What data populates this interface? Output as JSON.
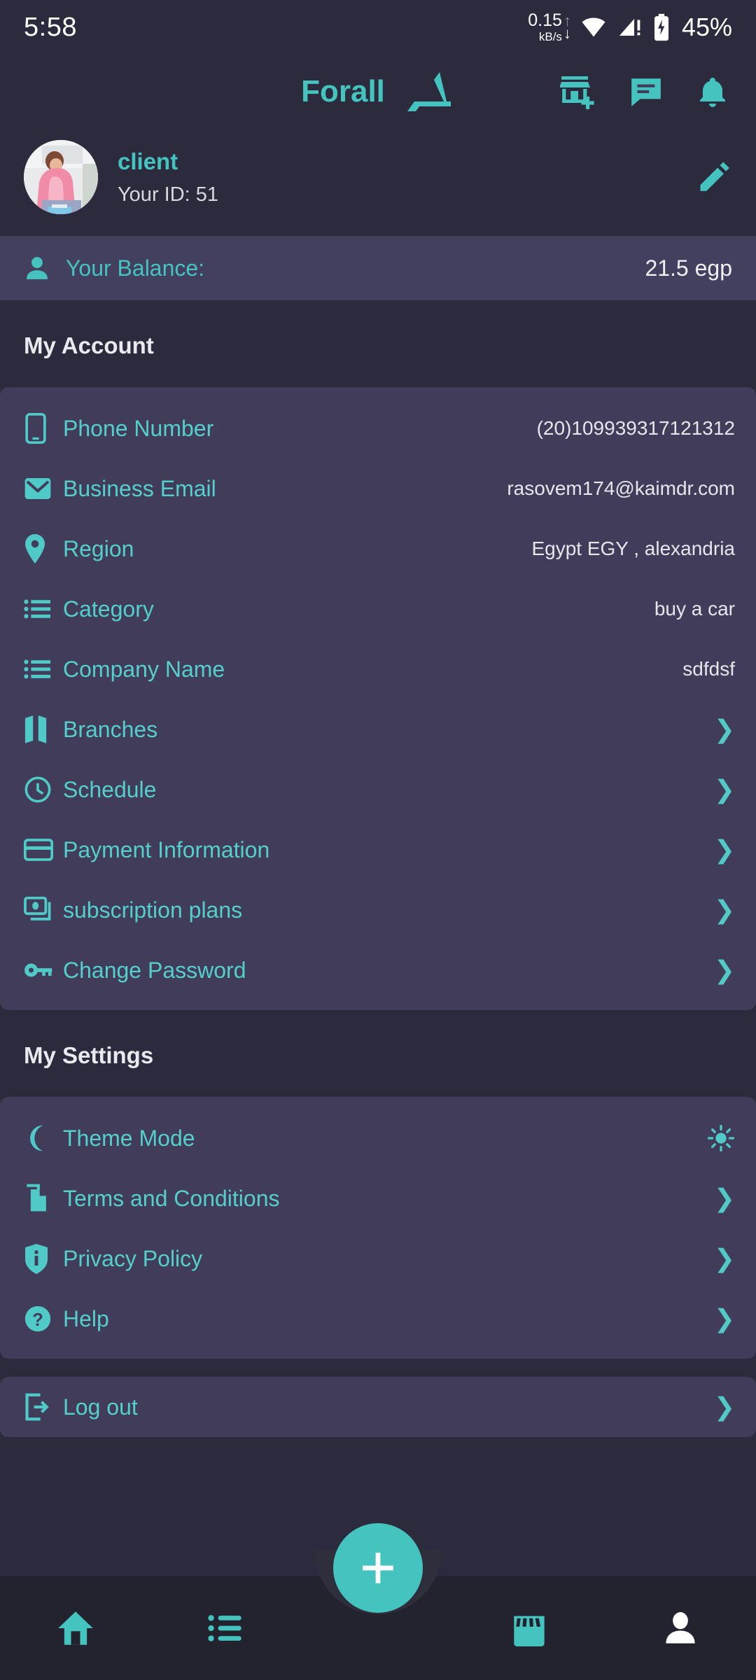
{
  "status_bar": {
    "time": "5:58",
    "net_speed_value": "0.15",
    "net_speed_unit": "kB/s",
    "up_arrow": "↑",
    "down_arrow": "↓",
    "battery_percent": "45%",
    "icons": [
      "upload-arrow-icon",
      "download-arrow-icon",
      "wifi-icon",
      "cellular-signal-warning-icon",
      "battery-icon"
    ]
  },
  "header": {
    "brand_name": "Forall",
    "logo_icon": "forall-arabic-logo-icon",
    "icons": [
      {
        "name": "add-store-icon"
      },
      {
        "name": "chat-message-icon"
      },
      {
        "name": "notification-bell-icon"
      }
    ]
  },
  "profile": {
    "name": "client",
    "id_label": "Your ID: 51",
    "avatar_icon": "user-avatar-photo",
    "edit_icon": "edit-pencil-icon"
  },
  "balance": {
    "icon": "person-icon",
    "label": "Your Balance:",
    "value": "21.5 egp"
  },
  "my_account": {
    "title": "My Account",
    "rows": [
      {
        "icon": "mobile-phone-icon",
        "label": "Phone Number",
        "value": "(20)109939317121312",
        "chevron": false
      },
      {
        "icon": "envelope-icon",
        "label": "Business Email",
        "value": "rasovem174@kaimdr.com",
        "chevron": false
      },
      {
        "icon": "map-pin-icon",
        "label": "Region",
        "value": "Egypt EGY , alexandria",
        "chevron": false
      },
      {
        "icon": "list-icon",
        "label": "Category",
        "value": "buy a car",
        "chevron": false
      },
      {
        "icon": "list-icon",
        "label": "Company Name",
        "value": "sdfdsf",
        "chevron": false
      },
      {
        "icon": "map-folded-icon",
        "label": "Branches",
        "value": "",
        "chevron": true
      },
      {
        "icon": "clock-icon",
        "label": "Schedule",
        "value": "",
        "chevron": true
      },
      {
        "icon": "credit-card-icon",
        "label": "Payment Information",
        "value": "",
        "chevron": true
      },
      {
        "icon": "subscription-cards-icon",
        "label": "subscription plans",
        "value": "",
        "chevron": true
      },
      {
        "icon": "key-icon",
        "label": "Change Password",
        "value": "",
        "chevron": true
      }
    ]
  },
  "my_settings": {
    "title": "My Settings",
    "rows": [
      {
        "icon": "moon-icon",
        "label": "Theme Mode",
        "right_icon": "sun-icon",
        "chevron": false
      },
      {
        "icon": "document-copy-icon",
        "label": "Terms and Conditions",
        "right_icon": "",
        "chevron": true
      },
      {
        "icon": "shield-info-icon",
        "label": "Privacy Policy",
        "right_icon": "",
        "chevron": true
      },
      {
        "icon": "question-circle-icon",
        "label": "Help",
        "right_icon": "",
        "chevron": true
      }
    ]
  },
  "logout": {
    "icon": "logout-exit-icon",
    "label": "Log out",
    "chevron": true
  },
  "bottom_nav": {
    "fab_icon": "plus-icon",
    "items": [
      {
        "icon": "home-icon",
        "active": false
      },
      {
        "icon": "list-lines-icon",
        "active": false
      },
      {
        "icon": "store-icon",
        "active": false
      },
      {
        "icon": "person-icon",
        "active": true
      }
    ]
  },
  "colors": {
    "background": "#2b2b3d",
    "card": "#403c5a",
    "accent": "#45c4bf",
    "label_text": "#55cfca",
    "value_text": "#e6e6ec",
    "nav_bar": "#23232f",
    "balance_bar": "#433f5e"
  },
  "chevron_glyph": "❯"
}
